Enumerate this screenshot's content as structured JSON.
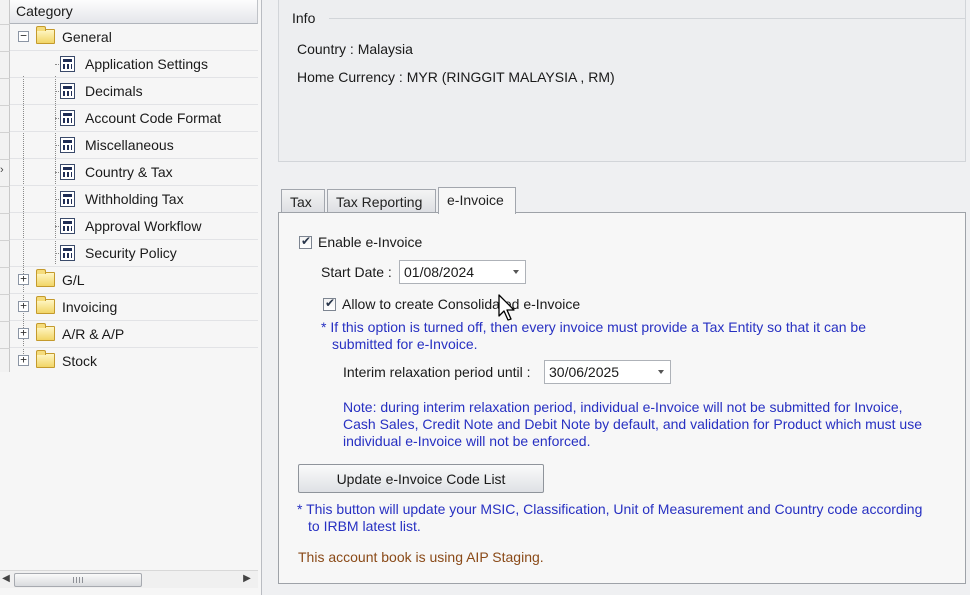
{
  "category": {
    "header": "Category",
    "tree": [
      {
        "label": "General",
        "expanded": true,
        "children": [
          "Application Settings",
          "Decimals",
          "Account Code Format",
          "Miscellaneous",
          "Country & Tax",
          "Withholding Tax",
          "Approval Workflow",
          "Security Policy"
        ]
      },
      {
        "label": "G/L",
        "expanded": false
      },
      {
        "label": "Invoicing",
        "expanded": false
      },
      {
        "label": "A/R & A/P",
        "expanded": false
      },
      {
        "label": "Stock",
        "expanded": false
      }
    ]
  },
  "info": {
    "legend": "Info",
    "country": "Country : Malaysia",
    "home_currency": "Home Currency : MYR (RINGGIT MALAYSIA , RM)"
  },
  "tabs": [
    {
      "label": "Tax",
      "active": false
    },
    {
      "label": "Tax Reporting",
      "active": false
    },
    {
      "label": "e-Invoice",
      "active": true
    }
  ],
  "einvoice": {
    "enable_label": "Enable e-Invoice",
    "enable_checked": true,
    "start_date_label": "Start Date :",
    "start_date_value": "01/08/2024",
    "consolidated_label": "Allow to create Consolidated e-Invoice",
    "consolidated_checked": true,
    "consolidated_note_1": "* If this option is turned off, then every invoice must provide a Tax Entity so that it can be",
    "consolidated_note_2": "submitted for e-Invoice.",
    "interim_label": "Interim relaxation period until :",
    "interim_value": "30/06/2025",
    "interim_note_1": "Note: during interim relaxation period, individual e-Invoice will not be submitted for Invoice,",
    "interim_note_2": "Cash Sales, Credit Note and Debit Note by default, and validation for Product which must use",
    "interim_note_3": "individual e-Invoice will not be enforced.",
    "update_button_label": "Update e-Invoice Code List",
    "update_note_1": "* This button will update your MSIC, Classification, Unit of Measurement and Country code according",
    "update_note_2": "to IRBM latest list.",
    "aip_note": "This account book is using AIP Staging."
  },
  "colors": {
    "note_blue": "#2730c2",
    "aip_brown": "#8a4a18",
    "panel_bg": "#eff0f2"
  }
}
